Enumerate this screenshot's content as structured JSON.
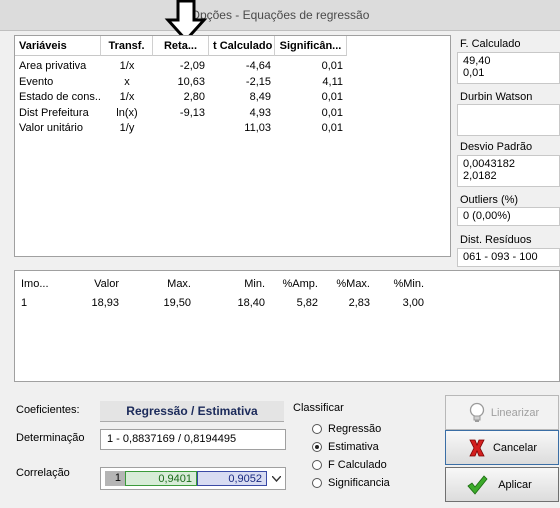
{
  "window": {
    "title": "Opções - Equações de regressão"
  },
  "regression_table": {
    "columns": [
      "Variáveis",
      "Transf.",
      "Reta...",
      "t Calculado",
      "Significân..."
    ],
    "rows": [
      [
        "Area privativa",
        "1/x",
        "-2,09",
        "-4,64",
        "0,01"
      ],
      [
        "Evento",
        "x",
        "10,63",
        "-2,15",
        "4,11"
      ],
      [
        "Estado de cons...",
        "1/x",
        "2,80",
        "8,49",
        "0,01"
      ],
      [
        "Dist Prefeitura",
        "ln(x)",
        "-9,13",
        "4,93",
        "0,01"
      ],
      [
        "Valor unitário",
        "1/y",
        "",
        "11,03",
        "0,01"
      ]
    ]
  },
  "stats": {
    "f_calculado": {
      "label": "F. Calculado",
      "lines": [
        "49,40",
        "0,01"
      ]
    },
    "durbin_watson": {
      "label": "Durbin Watson",
      "lines": []
    },
    "desvio_padrao": {
      "label": "Desvio Padrão",
      "lines": [
        "0,0043182",
        "2,0182"
      ]
    },
    "outliers": {
      "label": "Outliers (%)",
      "value": "0  (0,00%)"
    },
    "dist_residuos": {
      "label": "Dist. Resíduos",
      "value": "061 - 093 - 100"
    }
  },
  "residuals_table": {
    "columns": [
      "Imo...",
      "Valor",
      "Max.",
      "Min.",
      "%Amp.",
      "%Max.",
      "%Min."
    ],
    "rows": [
      [
        "1",
        "18,93",
        "19,50",
        "18,40",
        "5,82",
        "2,83",
        "3,00"
      ]
    ]
  },
  "coeficientes": {
    "label": "Coeficientes:",
    "tab_label": "Regressão / Estimativa",
    "determinacao_label": "Determinação",
    "determinacao_value": "1 - 0,8837169  /  0,8194495",
    "correlacao_label": "Correlação",
    "correlacao_values": [
      "1",
      "0,9401",
      "0,9052"
    ]
  },
  "classificar": {
    "title": "Classificar",
    "options": [
      "Regressão",
      "Estimativa",
      "F Calculado",
      "Significancia"
    ],
    "selected": "Estimativa"
  },
  "buttons": {
    "linearizar": "Linearizar",
    "cancelar": "Cancelar",
    "aplicar": "Aplicar"
  }
}
